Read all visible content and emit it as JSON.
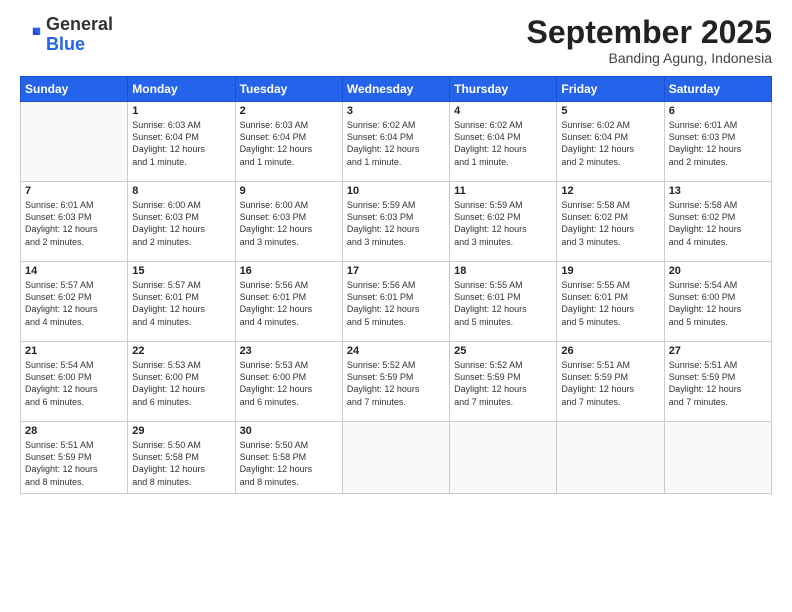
{
  "header": {
    "logo": {
      "line1": "General",
      "line2": "Blue"
    },
    "month": "September 2025",
    "location": "Banding Agung, Indonesia"
  },
  "weekdays": [
    "Sunday",
    "Monday",
    "Tuesday",
    "Wednesday",
    "Thursday",
    "Friday",
    "Saturday"
  ],
  "weeks": [
    [
      {
        "day": "",
        "info": ""
      },
      {
        "day": "1",
        "info": "Sunrise: 6:03 AM\nSunset: 6:04 PM\nDaylight: 12 hours\nand 1 minute."
      },
      {
        "day": "2",
        "info": "Sunrise: 6:03 AM\nSunset: 6:04 PM\nDaylight: 12 hours\nand 1 minute."
      },
      {
        "day": "3",
        "info": "Sunrise: 6:02 AM\nSunset: 6:04 PM\nDaylight: 12 hours\nand 1 minute."
      },
      {
        "day": "4",
        "info": "Sunrise: 6:02 AM\nSunset: 6:04 PM\nDaylight: 12 hours\nand 1 minute."
      },
      {
        "day": "5",
        "info": "Sunrise: 6:02 AM\nSunset: 6:04 PM\nDaylight: 12 hours\nand 2 minutes."
      },
      {
        "day": "6",
        "info": "Sunrise: 6:01 AM\nSunset: 6:03 PM\nDaylight: 12 hours\nand 2 minutes."
      }
    ],
    [
      {
        "day": "7",
        "info": "Sunrise: 6:01 AM\nSunset: 6:03 PM\nDaylight: 12 hours\nand 2 minutes."
      },
      {
        "day": "8",
        "info": "Sunrise: 6:00 AM\nSunset: 6:03 PM\nDaylight: 12 hours\nand 2 minutes."
      },
      {
        "day": "9",
        "info": "Sunrise: 6:00 AM\nSunset: 6:03 PM\nDaylight: 12 hours\nand 3 minutes."
      },
      {
        "day": "10",
        "info": "Sunrise: 5:59 AM\nSunset: 6:03 PM\nDaylight: 12 hours\nand 3 minutes."
      },
      {
        "day": "11",
        "info": "Sunrise: 5:59 AM\nSunset: 6:02 PM\nDaylight: 12 hours\nand 3 minutes."
      },
      {
        "day": "12",
        "info": "Sunrise: 5:58 AM\nSunset: 6:02 PM\nDaylight: 12 hours\nand 3 minutes."
      },
      {
        "day": "13",
        "info": "Sunrise: 5:58 AM\nSunset: 6:02 PM\nDaylight: 12 hours\nand 4 minutes."
      }
    ],
    [
      {
        "day": "14",
        "info": "Sunrise: 5:57 AM\nSunset: 6:02 PM\nDaylight: 12 hours\nand 4 minutes."
      },
      {
        "day": "15",
        "info": "Sunrise: 5:57 AM\nSunset: 6:01 PM\nDaylight: 12 hours\nand 4 minutes."
      },
      {
        "day": "16",
        "info": "Sunrise: 5:56 AM\nSunset: 6:01 PM\nDaylight: 12 hours\nand 4 minutes."
      },
      {
        "day": "17",
        "info": "Sunrise: 5:56 AM\nSunset: 6:01 PM\nDaylight: 12 hours\nand 5 minutes."
      },
      {
        "day": "18",
        "info": "Sunrise: 5:55 AM\nSunset: 6:01 PM\nDaylight: 12 hours\nand 5 minutes."
      },
      {
        "day": "19",
        "info": "Sunrise: 5:55 AM\nSunset: 6:01 PM\nDaylight: 12 hours\nand 5 minutes."
      },
      {
        "day": "20",
        "info": "Sunrise: 5:54 AM\nSunset: 6:00 PM\nDaylight: 12 hours\nand 5 minutes."
      }
    ],
    [
      {
        "day": "21",
        "info": "Sunrise: 5:54 AM\nSunset: 6:00 PM\nDaylight: 12 hours\nand 6 minutes."
      },
      {
        "day": "22",
        "info": "Sunrise: 5:53 AM\nSunset: 6:00 PM\nDaylight: 12 hours\nand 6 minutes."
      },
      {
        "day": "23",
        "info": "Sunrise: 5:53 AM\nSunset: 6:00 PM\nDaylight: 12 hours\nand 6 minutes."
      },
      {
        "day": "24",
        "info": "Sunrise: 5:52 AM\nSunset: 5:59 PM\nDaylight: 12 hours\nand 7 minutes."
      },
      {
        "day": "25",
        "info": "Sunrise: 5:52 AM\nSunset: 5:59 PM\nDaylight: 12 hours\nand 7 minutes."
      },
      {
        "day": "26",
        "info": "Sunrise: 5:51 AM\nSunset: 5:59 PM\nDaylight: 12 hours\nand 7 minutes."
      },
      {
        "day": "27",
        "info": "Sunrise: 5:51 AM\nSunset: 5:59 PM\nDaylight: 12 hours\nand 7 minutes."
      }
    ],
    [
      {
        "day": "28",
        "info": "Sunrise: 5:51 AM\nSunset: 5:59 PM\nDaylight: 12 hours\nand 8 minutes."
      },
      {
        "day": "29",
        "info": "Sunrise: 5:50 AM\nSunset: 5:58 PM\nDaylight: 12 hours\nand 8 minutes."
      },
      {
        "day": "30",
        "info": "Sunrise: 5:50 AM\nSunset: 5:58 PM\nDaylight: 12 hours\nand 8 minutes."
      },
      {
        "day": "",
        "info": ""
      },
      {
        "day": "",
        "info": ""
      },
      {
        "day": "",
        "info": ""
      },
      {
        "day": "",
        "info": ""
      }
    ]
  ]
}
